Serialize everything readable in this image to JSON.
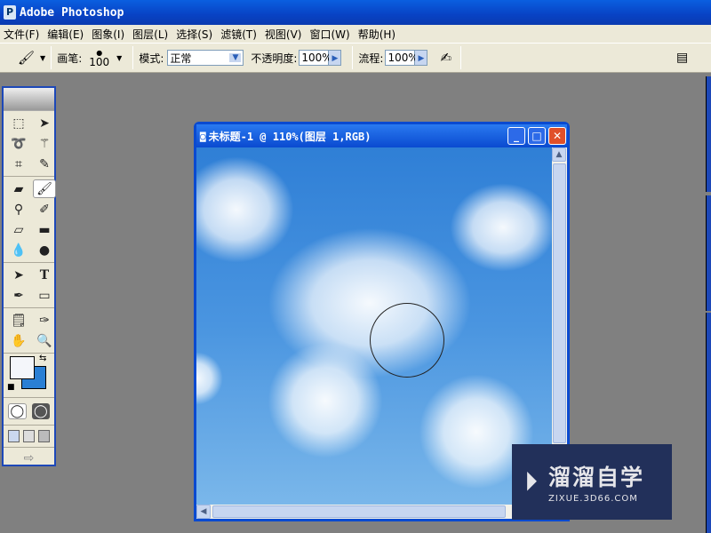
{
  "app": {
    "title": "Adobe Photoshop"
  },
  "menu": [
    "文件(F)",
    "编辑(E)",
    "图象(I)",
    "图层(L)",
    "选择(S)",
    "滤镜(T)",
    "视图(V)",
    "窗口(W)",
    "帮助(H)"
  ],
  "options": {
    "brush_label": "画笔:",
    "brush_size": "100",
    "mode_label": "模式:",
    "mode_value": "正常",
    "opacity_label": "不透明度:",
    "opacity_value": "100%",
    "flow_label": "流程:",
    "flow_value": "100%"
  },
  "document": {
    "title": "未标题-1 @ 110%(图层 1,RGB)"
  },
  "colors": {
    "foreground": "#f4f6fa",
    "background": "#2a7fd4"
  },
  "watermark": {
    "title": "溜溜自学",
    "url": "ZIXUE.3D66.COM"
  }
}
